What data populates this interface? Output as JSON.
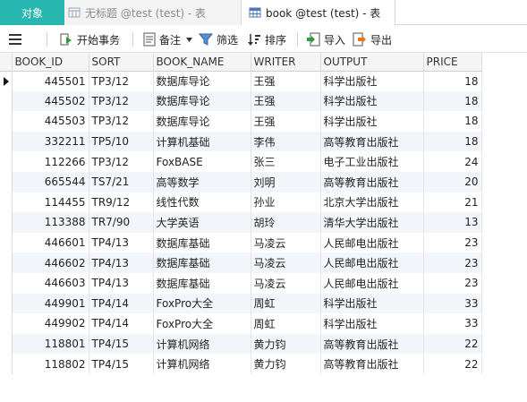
{
  "tabs": {
    "objects": "对象",
    "untitled": "无标题 @test (test) - 表",
    "book": "book @test (test) - 表"
  },
  "toolbar": {
    "begin_transaction": "开始事务",
    "memo": "备注",
    "filter": "筛选",
    "sort": "排序",
    "import": "导入",
    "export": "导出"
  },
  "grid": {
    "columns": [
      "BOOK_ID",
      "SORT",
      "BOOK_NAME",
      "WRITER",
      "OUTPUT",
      "PRICE"
    ],
    "rows": [
      [
        "445501",
        "TP3/12",
        "数据库导论",
        "王强",
        "科学出版社",
        "18"
      ],
      [
        "445502",
        "TP3/12",
        "数据库导论",
        "王强",
        "科学出版社",
        "18"
      ],
      [
        "445503",
        "TP3/12",
        "数据库导论",
        "王强",
        "科学出版社",
        "18"
      ],
      [
        "332211",
        "TP5/10",
        "计算机基础",
        "李伟",
        "高等教育出版社",
        "18"
      ],
      [
        "112266",
        "TP3/12",
        "FoxBASE",
        "张三",
        "电子工业出版社",
        "24"
      ],
      [
        "665544",
        "TS7/21",
        "高等数学",
        "刘明",
        "高等教育出版社",
        "20"
      ],
      [
        "114455",
        "TR9/12",
        "线性代数",
        "孙业",
        "北京大学出版社",
        "21"
      ],
      [
        "113388",
        "TR7/90",
        "大学英语",
        "胡玲",
        "清华大学出版社",
        "13"
      ],
      [
        "446601",
        "TP4/13",
        "数据库基础",
        "马凌云",
        "人民邮电出版社",
        "23"
      ],
      [
        "446602",
        "TP4/13",
        "数据库基础",
        "马凌云",
        "人民邮电出版社",
        "23"
      ],
      [
        "446603",
        "TP4/13",
        "数据库基础",
        "马凌云",
        "人民邮电出版社",
        "23"
      ],
      [
        "449901",
        "TP4/14",
        "FoxPro大全",
        "周虹",
        "科学出版社",
        "33"
      ],
      [
        "449902",
        "TP4/14",
        "FoxPro大全",
        "周虹",
        "科学出版社",
        "33"
      ],
      [
        "118801",
        "TP4/15",
        "计算机网络",
        "黄力钧",
        "高等教育出版社",
        "22"
      ],
      [
        "118802",
        "TP4/15",
        "计算机网络",
        "黄力钧",
        "高等教育出版社",
        "22"
      ]
    ]
  },
  "colors": {
    "accent": "#27b7b0",
    "row_alt": "#f2f6fb"
  }
}
